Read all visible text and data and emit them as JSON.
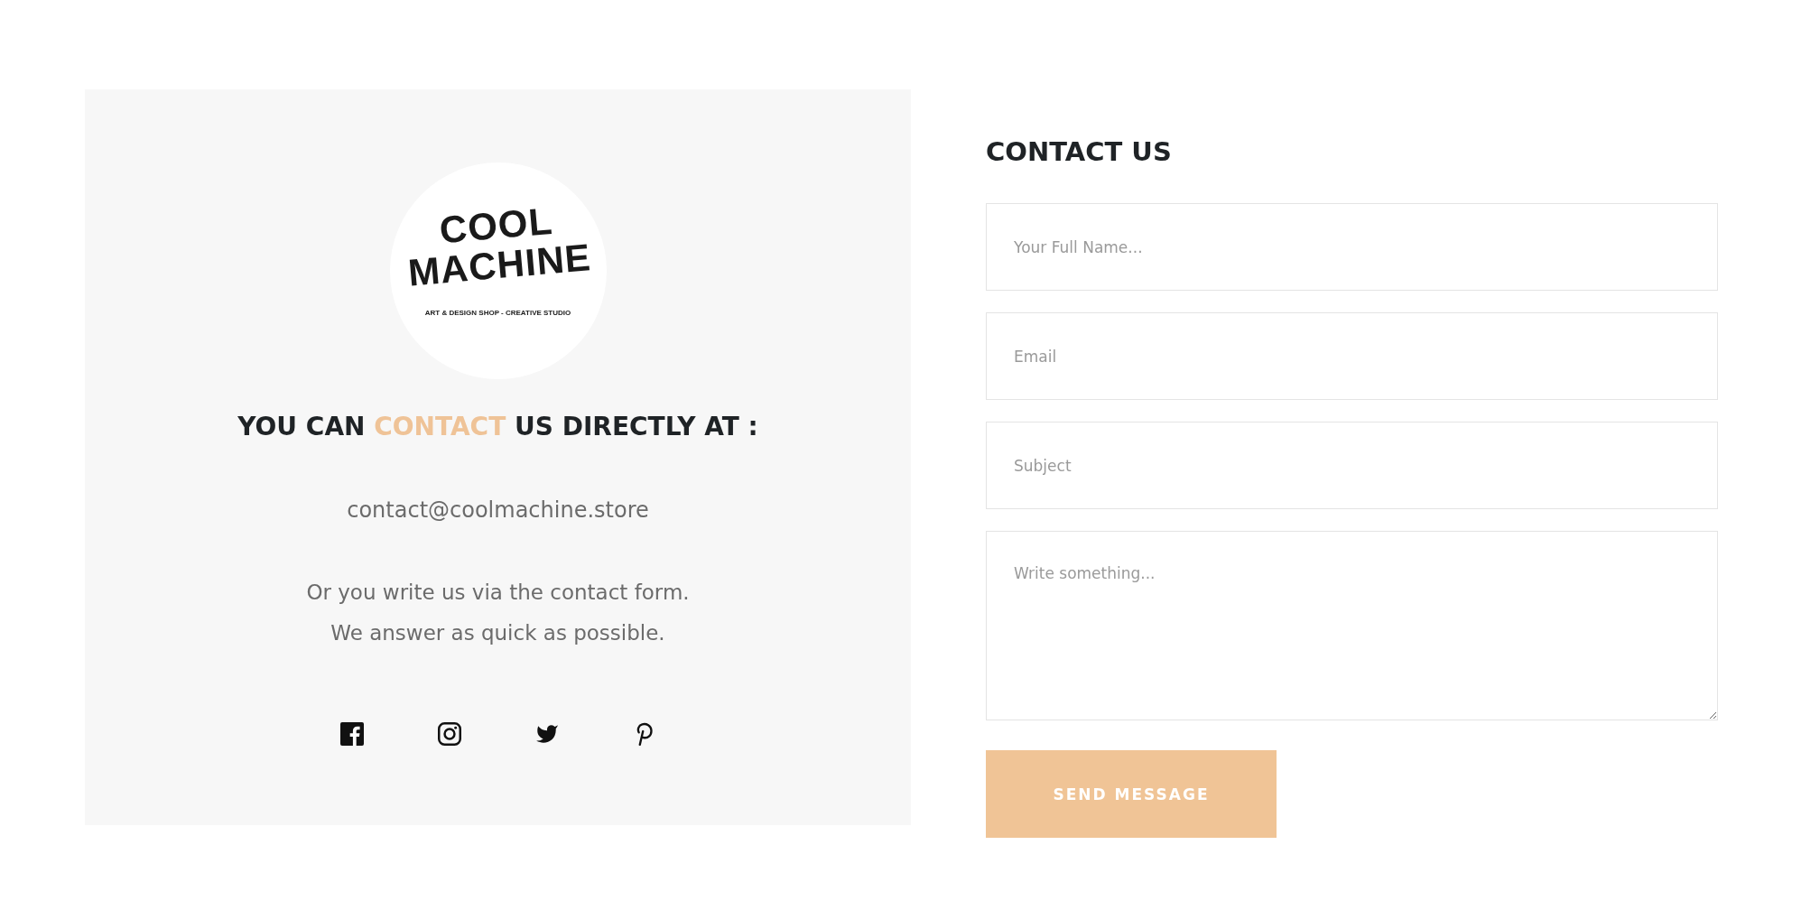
{
  "info_panel": {
    "logo": {
      "wordmark_lines": [
        "COOL",
        "MACHINE"
      ],
      "tagline": "ART & DESIGN SHOP - CREATIVE STUDIO"
    },
    "heading": [
      {
        "text": "YOU CAN",
        "highlight": false
      },
      {
        "text": "CONTACT",
        "highlight": true
      },
      {
        "text": "US DIRECTLY AT :",
        "highlight": false
      }
    ],
    "email": "contact@coolmachine.store",
    "note_lines": [
      "Or you write us via the contact form.",
      "We answer as quick as possible."
    ]
  },
  "contact_form": {
    "title": "CONTACT US",
    "fields": [
      {
        "kind": "text",
        "placeholder": "Your Full Name..."
      },
      {
        "kind": "text",
        "placeholder": "Email"
      },
      {
        "kind": "text",
        "placeholder": "Subject"
      },
      {
        "kind": "textarea",
        "placeholder": "Write something..."
      }
    ],
    "submit_button": "SEND MESSAGE"
  }
}
